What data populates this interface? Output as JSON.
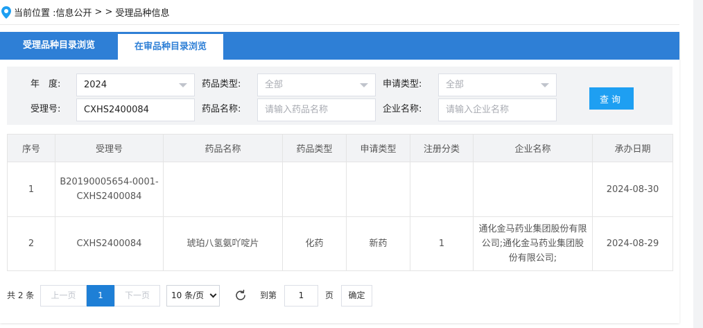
{
  "breadcrumb": {
    "prefix": "当前位置 : ",
    "section": "信息公开",
    "separator": "> >",
    "current": "受理品种信息"
  },
  "tabs": [
    {
      "label": "受理品种目录浏览",
      "active": false
    },
    {
      "label": "在审品种目录浏览",
      "active": true
    }
  ],
  "filters": {
    "year": {
      "label": "年　度:",
      "value": "2024"
    },
    "acceptance_no": {
      "label": "受理号:",
      "value": "CXHS2400084"
    },
    "drug_type": {
      "label": "药品类型:",
      "value": "全部"
    },
    "drug_name": {
      "label": "药品名称:",
      "placeholder": "请输入药品名称"
    },
    "apply_type": {
      "label": "申请类型:",
      "value": "全部"
    },
    "company_name": {
      "label": "企业名称:",
      "placeholder": "请输入企业名称"
    },
    "search_label": "查询"
  },
  "table": {
    "headers": [
      "序号",
      "受理号",
      "药品名称",
      "药品类型",
      "申请类型",
      "注册分类",
      "企业名称",
      "承办日期"
    ],
    "rows": [
      [
        "1",
        "B20190005654-0001-CXHS2400084",
        "",
        "",
        "",
        "",
        "",
        "2024-08-30"
      ],
      [
        "2",
        "CXHS2400084",
        "琥珀八氢氨吖啶片",
        "化药",
        "新药",
        "1",
        "通化金马药业集团股份有限公司;通化金马药业集团股份有限公司;",
        "2024-08-29"
      ]
    ]
  },
  "pager": {
    "total": "共 2 条",
    "prev": "上一页",
    "current_page": "1",
    "next": "下一页",
    "page_size": "10 条/页",
    "goto_prefix": "到第",
    "goto_value": "1",
    "goto_suffix": "页",
    "confirm": "确定"
  },
  "colors": {
    "tab_bar": "#2e7fd6",
    "search_button": "#1e9ff2",
    "active_page": "#1e7fd6"
  }
}
